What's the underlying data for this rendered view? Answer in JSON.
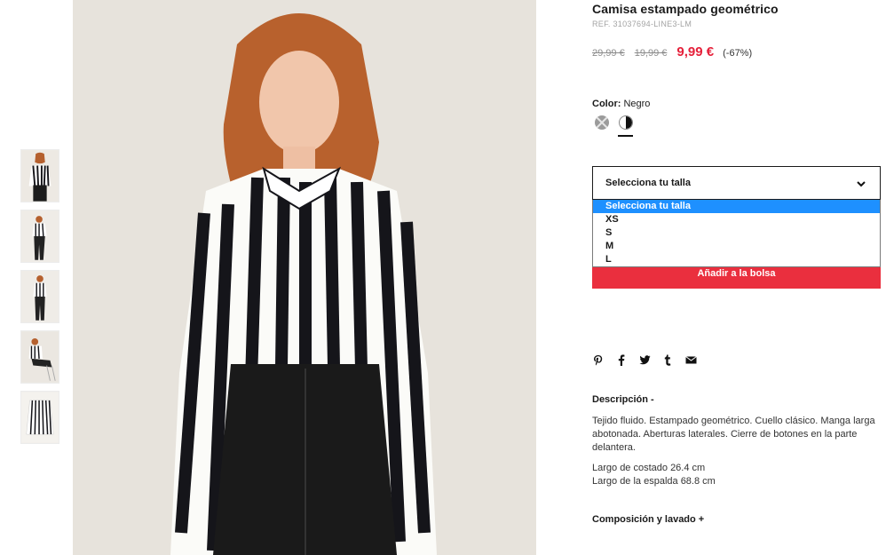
{
  "product": {
    "title": "Camisa estampado geométrico",
    "ref": "REF. 31037694-LINE3-LM",
    "prices": {
      "original": "29,99 €",
      "previous": "19,99 €",
      "current": "9,99 €",
      "discount": "(-67%)"
    },
    "color": {
      "label": "Color:",
      "value": "Negro"
    },
    "size_select": {
      "placeholder": "Selecciona tu talla",
      "options": [
        "Selecciona tu talla",
        "XS",
        "S",
        "M",
        "L"
      ]
    },
    "add_to_bag": "Añadir a la bolsa",
    "description": {
      "title": "Descripción -",
      "text": "Tejido fluido. Estampado geométrico. Cuello clásico. Manga larga abotonada. Aberturas laterales. Cierre de botones en la parte delantera.",
      "side_length": "Largo de costado 26.4 cm",
      "back_length": "Largo de la espalda 68.8 cm"
    },
    "composition_title": "Composición y lavado +"
  },
  "social_icons": [
    "pinterest-icon",
    "facebook-icon",
    "twitter-icon",
    "tumblr-icon",
    "email-icon"
  ],
  "colors": {
    "sale": "#e5203a",
    "button": "#ea2f3e",
    "highlight": "#1e90ff",
    "stripe": "#15151a"
  }
}
